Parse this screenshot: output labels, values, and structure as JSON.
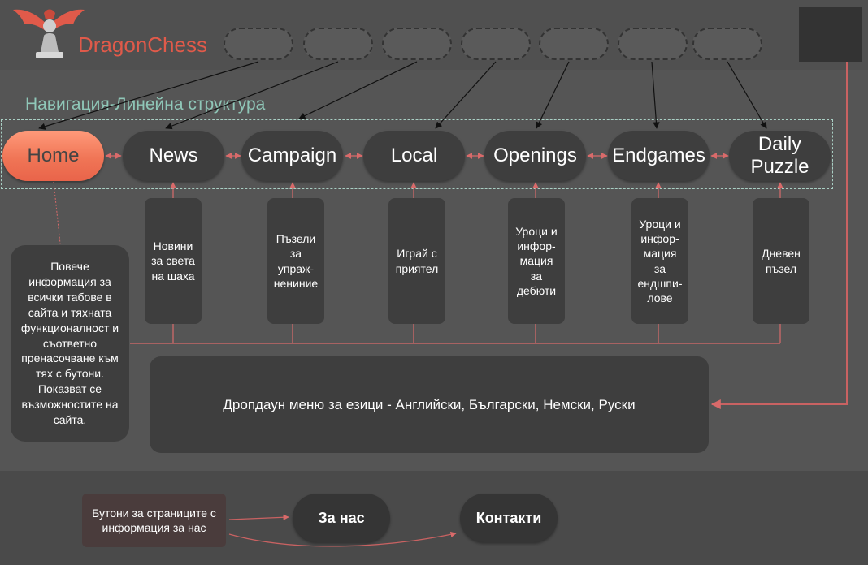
{
  "header": {
    "brand": "DragonChess",
    "logo_icon": "dragon-chess-pawn-logo",
    "placeholders": 7
  },
  "navigation": {
    "title": "Навигация-Линейна структура",
    "tabs": [
      {
        "label": "Home",
        "description": ""
      },
      {
        "label": "News",
        "description": "Новини за света на шаха"
      },
      {
        "label": "Campaign",
        "description": "Пъзели за упраж-нениние"
      },
      {
        "label": "Local",
        "description": "Играй с приятел"
      },
      {
        "label": "Openings",
        "description": "Уроци и инфор-мация за дебюти"
      },
      {
        "label": "Endgames",
        "description": "Уроци и инфор-мация за ендшпи-лове"
      },
      {
        "label": "Daily Puzzle",
        "description": "Дневен пъзел"
      }
    ]
  },
  "home_info": "Повече информация за всички табове в сайта и тяхната функционалност и съответно пренасочване към тях с бутони. Показват се възможностите на сайта.",
  "language_menu": "Дропдаун меню за езици - Английски, Български, Немски, Руски",
  "footer": {
    "note": "Бутони за страниците с информация за нас",
    "buttons": [
      "За нас",
      "Контакти"
    ]
  },
  "colors": {
    "accent": "#e05a4a",
    "home_tab": "#f07556",
    "teal_text": "#8fc7b8",
    "connector": "#d96a6a"
  }
}
